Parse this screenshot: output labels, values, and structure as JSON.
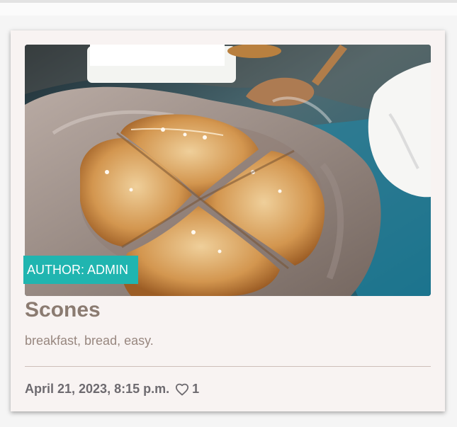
{
  "post": {
    "author_label": "AUTHOR: ADMIN",
    "title": "Scones",
    "tags": "breakfast, bread, easy.",
    "date": "April 21, 2023, 8:15 p.m.",
    "likes": "1"
  },
  "icons": {
    "like": "heart-icon"
  },
  "colors": {
    "badge": "#20b5b0",
    "title": "#8b7b71",
    "card_background": "#f8f3f2"
  }
}
